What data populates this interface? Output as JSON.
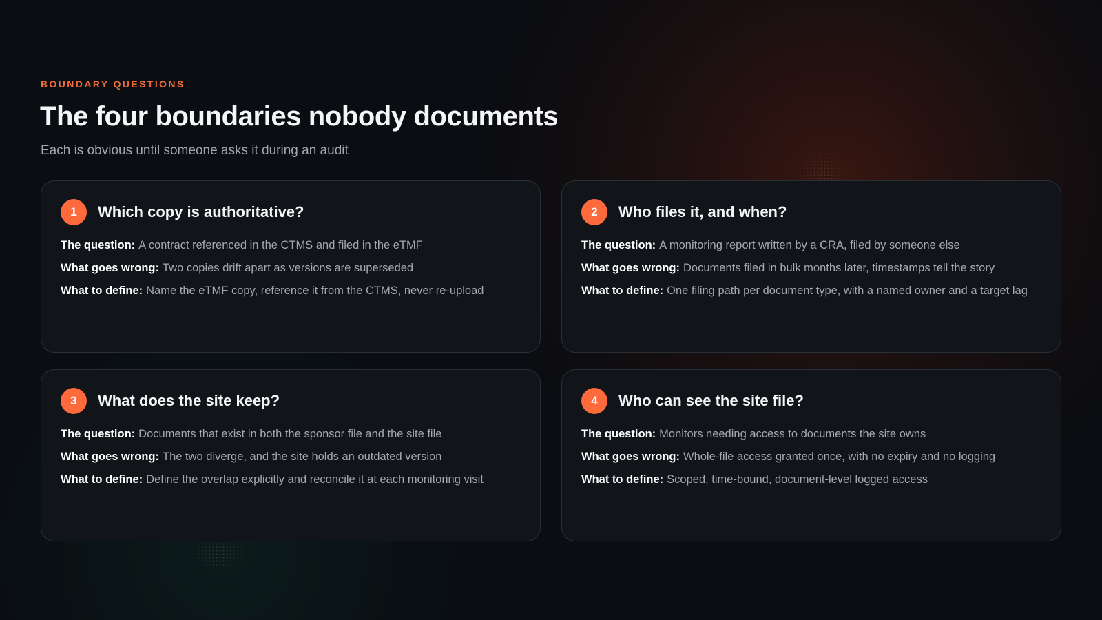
{
  "header": {
    "eyebrow": "BOUNDARY QUESTIONS",
    "title": "The four boundaries nobody documents",
    "subtitle": "Each is obvious until someone asks it during an audit"
  },
  "colors": {
    "accent": "#ff6a3d",
    "eyebrow": "#f06a3a",
    "background": "#0a0d12",
    "card_background": "#111419",
    "card_border": "#2a2f37"
  },
  "cards": [
    {
      "number": "1",
      "title": "Which copy is authoritative?",
      "rows": [
        {
          "label": "The question:",
          "text": "A contract referenced in the CTMS and filed in the eTMF"
        },
        {
          "label": "What goes wrong:",
          "text": "Two copies drift apart as versions are superseded"
        },
        {
          "label": "What to define:",
          "text": "Name the eTMF copy, reference it from the CTMS, never re-upload"
        }
      ]
    },
    {
      "number": "2",
      "title": "Who files it, and when?",
      "rows": [
        {
          "label": "The question:",
          "text": "A monitoring report written by a CRA, filed by someone else"
        },
        {
          "label": "What goes wrong:",
          "text": "Documents filed in bulk months later, timestamps tell the story"
        },
        {
          "label": "What to define:",
          "text": "One filing path per document type, with a named owner and a target lag"
        }
      ]
    },
    {
      "number": "3",
      "title": "What does the site keep?",
      "rows": [
        {
          "label": "The question:",
          "text": "Documents that exist in both the sponsor file and the site file"
        },
        {
          "label": "What goes wrong:",
          "text": "The two diverge, and the site holds an outdated version"
        },
        {
          "label": "What to define:",
          "text": "Define the overlap explicitly and reconcile it at each monitoring visit"
        }
      ]
    },
    {
      "number": "4",
      "title": "Who can see the site file?",
      "rows": [
        {
          "label": "The question:",
          "text": "Monitors needing access to documents the site owns"
        },
        {
          "label": "What goes wrong:",
          "text": "Whole-file access granted once, with no expiry and no logging"
        },
        {
          "label": "What to define:",
          "text": "Scoped, time-bound, document-level logged access"
        }
      ]
    }
  ]
}
